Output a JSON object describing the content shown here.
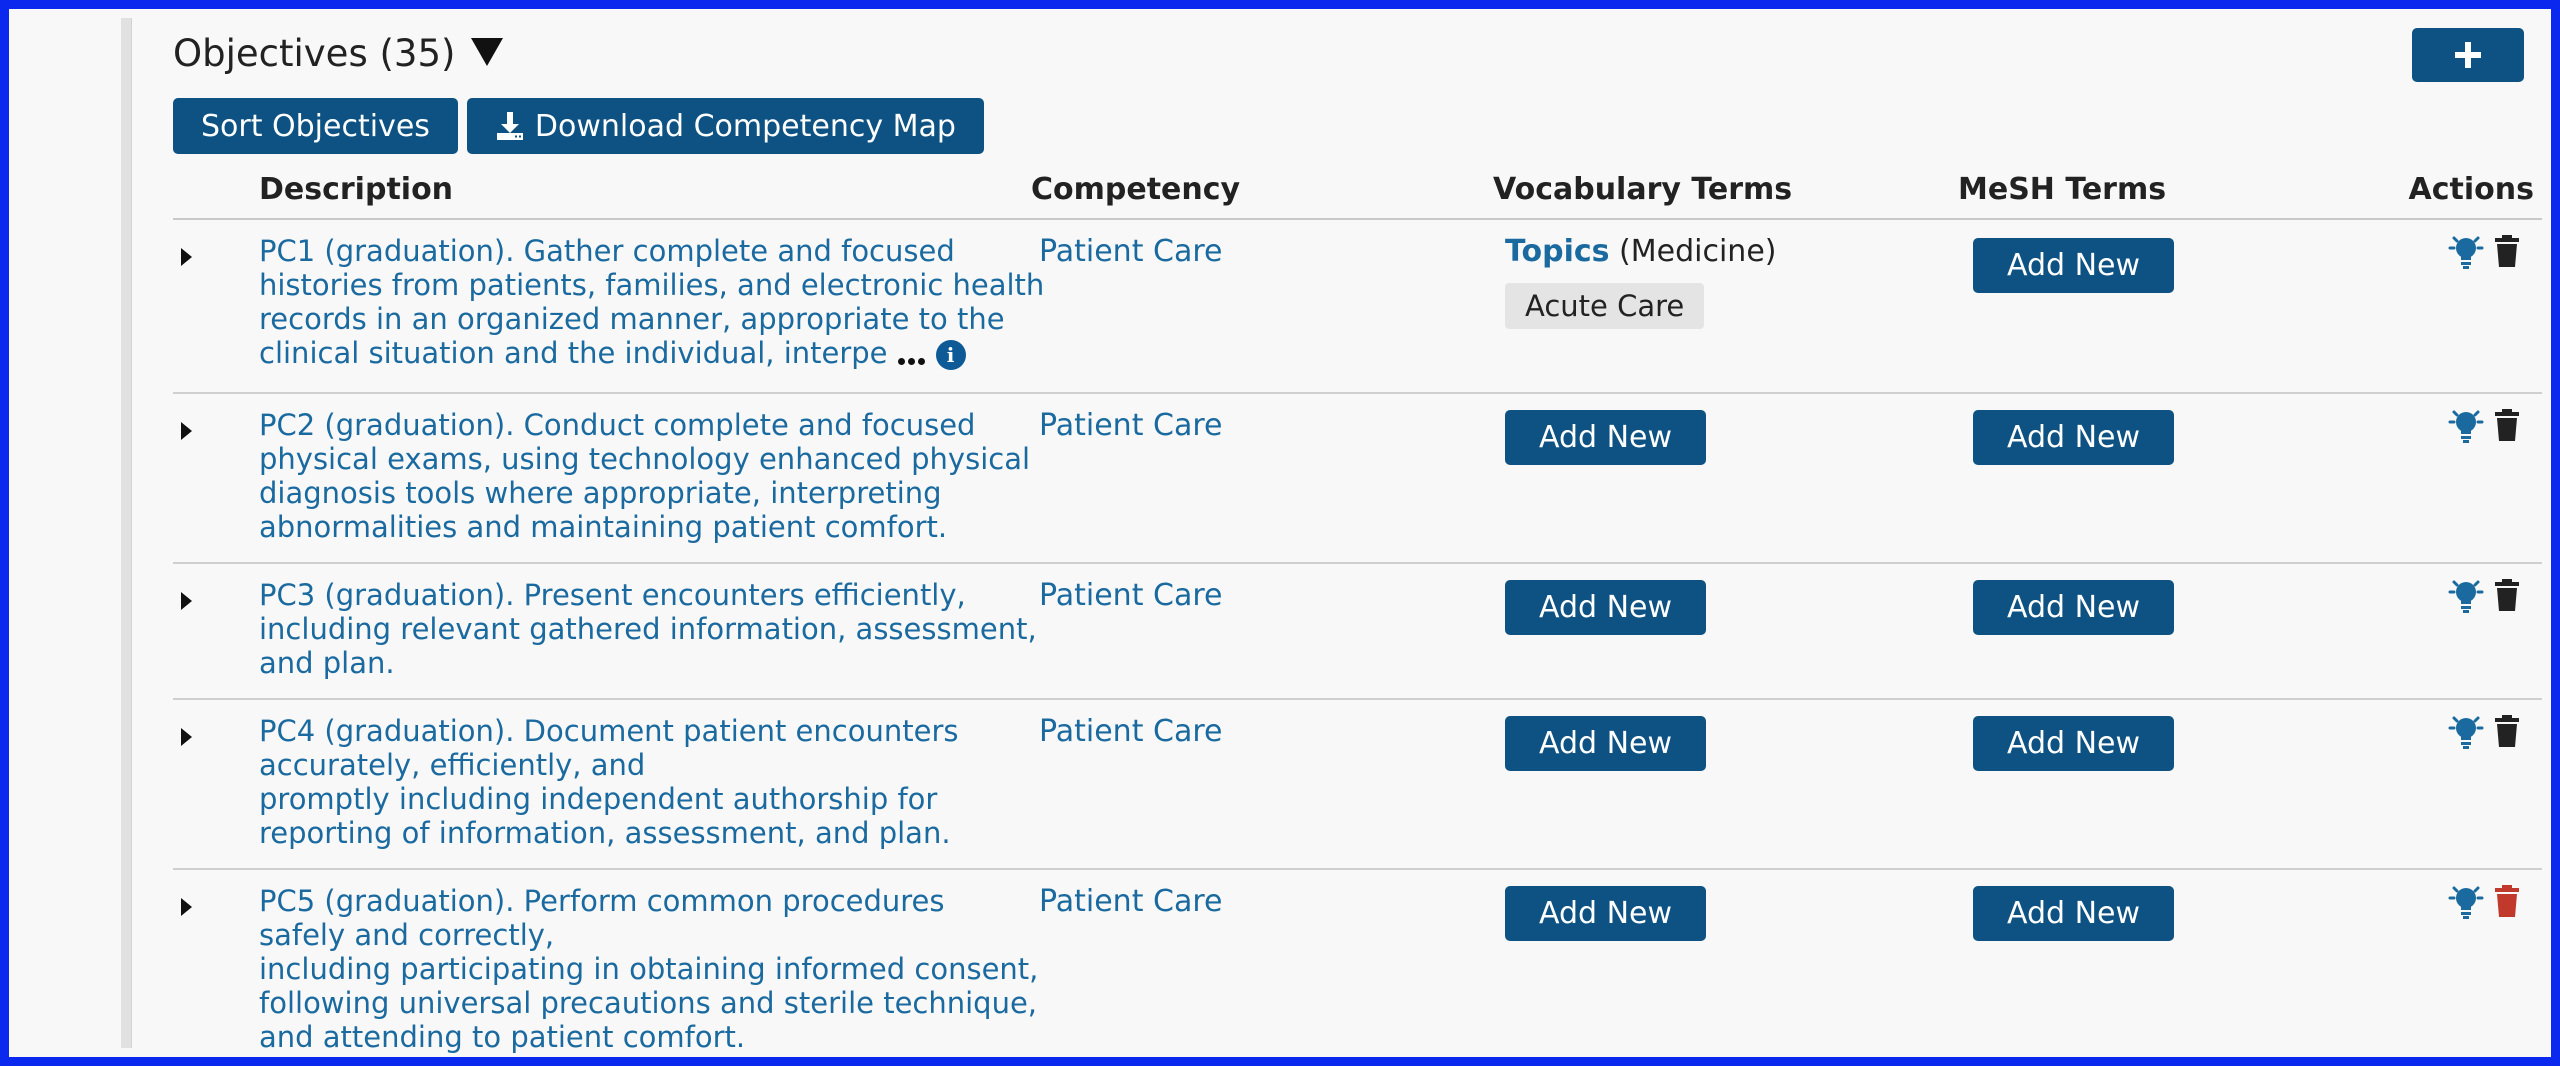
{
  "header": {
    "title": "Objectives (35)",
    "add_icon": "plus-icon",
    "sort_label": "Sort Objectives",
    "download_label": "Download Competency Map"
  },
  "table": {
    "columns": {
      "description": "Description",
      "competency": "Competency",
      "vocabulary": "Vocabulary Terms",
      "mesh": "MeSH Terms",
      "actions": "Actions"
    },
    "add_new_label": "Add New",
    "rows": [
      {
        "lines": [
          "PC1 (graduation). Gather complete and focused",
          "histories from patients, families, and electronic health",
          "records in an organized manner, appropriate to the",
          "clinical situation and the individual, interpe"
        ],
        "competency": "Patient Care",
        "vocab_link": "Topics",
        "vocab_scope": "(Medicine)",
        "vocab_tag": "Acute Care"
      },
      {
        "lines": [
          "PC2 (graduation). Conduct complete and focused",
          "physical exams, using technology enhanced physical",
          "diagnosis tools where appropriate, interpreting",
          "abnormalities and maintaining patient comfort."
        ],
        "competency": "Patient Care"
      },
      {
        "lines": [
          "PC3 (graduation). Present encounters efficiently,",
          "including relevant gathered information, assessment,",
          "and plan."
        ],
        "competency": "Patient Care"
      },
      {
        "lines": [
          "PC4 (graduation). Document patient encounters",
          "accurately, efficiently, and",
          "promptly including independent authorship for",
          "reporting of information, assessment, and plan."
        ],
        "competency": "Patient Care"
      },
      {
        "lines": [
          "PC5 (graduation). Perform common procedures",
          "safely and correctly,",
          "including participating in obtaining informed consent,",
          "following universal precautions and sterile technique,",
          "and attending to patient comfort."
        ],
        "competency": "Patient Care"
      }
    ]
  },
  "colors": {
    "primary_button": "#0d5282",
    "link": "#1a6aa0",
    "delete_hover": "#c0392b",
    "frame": "#0a28ee"
  },
  "icons": {
    "expand": "caret-right-icon",
    "more": "ellipsis-icon",
    "info": "info-icon",
    "edit": "lightbulb-icon",
    "delete": "trash-icon",
    "download": "download-icon"
  }
}
